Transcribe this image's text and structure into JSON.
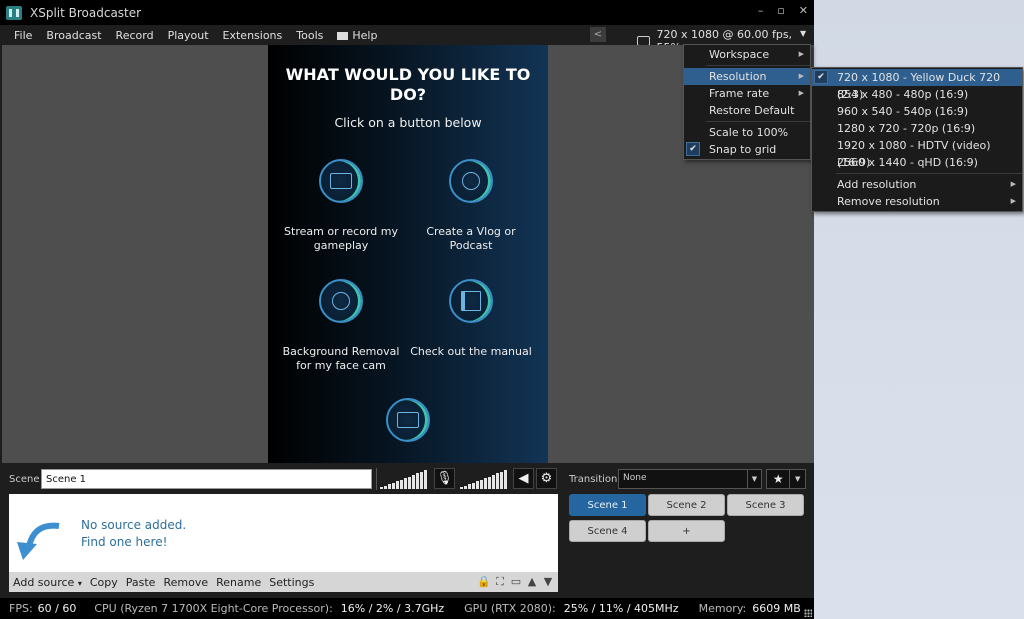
{
  "window": {
    "title": "XSplit Broadcaster",
    "controls": {
      "minimize": "–",
      "maximize": "▫",
      "close": "✕"
    }
  },
  "menubar": {
    "items": [
      "File",
      "Broadcast",
      "Record",
      "Playout",
      "Extensions",
      "Tools",
      "Help"
    ],
    "resolution_status": "720 x 1080 @ 60.00 fps, 55%"
  },
  "canvas": {
    "title": "WHAT WOULD YOU LIKE TO DO?",
    "subtitle": "Click on a button below",
    "options": [
      {
        "label": "Stream or record my gameplay",
        "icon": "monitor-gamepad-icon"
      },
      {
        "label": "Create a Vlog or Podcast",
        "icon": "vlog-person-icon"
      },
      {
        "label": "Background Removal for my face cam",
        "icon": "webcam-icon"
      },
      {
        "label": "Check out the manual",
        "icon": "book-icon"
      },
      {
        "label": "",
        "icon": "tutorial-video-icon"
      }
    ]
  },
  "context_menu": {
    "items": [
      {
        "label": "Workspace",
        "submenu": true
      },
      {
        "label": "Resolution",
        "submenu": true,
        "highlighted": true
      },
      {
        "label": "Frame rate",
        "submenu": true
      },
      {
        "label": "Restore Default"
      },
      {
        "label": "Scale to 100%"
      },
      {
        "label": "Snap to grid",
        "checked": true
      }
    ]
  },
  "resolution_submenu": {
    "items": [
      {
        "label": "720 x 1080 - Yellow Duck 720 (2:3)",
        "checked": true,
        "highlighted": true
      },
      {
        "label": "854 x 480 - 480p (16:9)"
      },
      {
        "label": "960 x 540 - 540p (16:9)"
      },
      {
        "label": "1280 x 720 - 720p (16:9)"
      },
      {
        "label": "1920 x 1080 - HDTV (video) (16:9)"
      },
      {
        "label": "2560 x 1440 - qHD (16:9)"
      }
    ],
    "extra": [
      {
        "label": "Add resolution",
        "submenu": true
      },
      {
        "label": "Remove resolution",
        "submenu": true
      }
    ]
  },
  "scene_panel": {
    "label": "Scene",
    "scene_name": "Scene 1",
    "mic_meter_level": 1.0,
    "speaker_meter_level": 1.0
  },
  "sources": {
    "empty_line1": "No source added.",
    "empty_line2": "Find one here!",
    "toolbar": [
      "Add source",
      "Copy",
      "Paste",
      "Remove",
      "Rename",
      "Settings"
    ],
    "add_source_caret": "▾"
  },
  "transition": {
    "label": "Transition",
    "value": "None"
  },
  "scenes": {
    "buttons": [
      "Scene 1",
      "Scene 2",
      "Scene 3",
      "Scene 4",
      "+"
    ],
    "active": "Scene 1"
  },
  "statusbar": {
    "fps_label": "FPS:",
    "fps_value": "60 / 60",
    "cpu_label": "CPU (Ryzen 7 1700X Eight-Core Processor):",
    "cpu_value": "16% / 2% / 3.7GHz",
    "gpu_label": "GPU (RTX 2080):",
    "gpu_value": "25% / 11% / 405MHz",
    "memory_label": "Memory:",
    "memory_value": "6609 MB"
  },
  "colors": {
    "accent": "#2f5f8f",
    "active_scene": "#2566a0",
    "source_hint": "#2d6f99"
  }
}
